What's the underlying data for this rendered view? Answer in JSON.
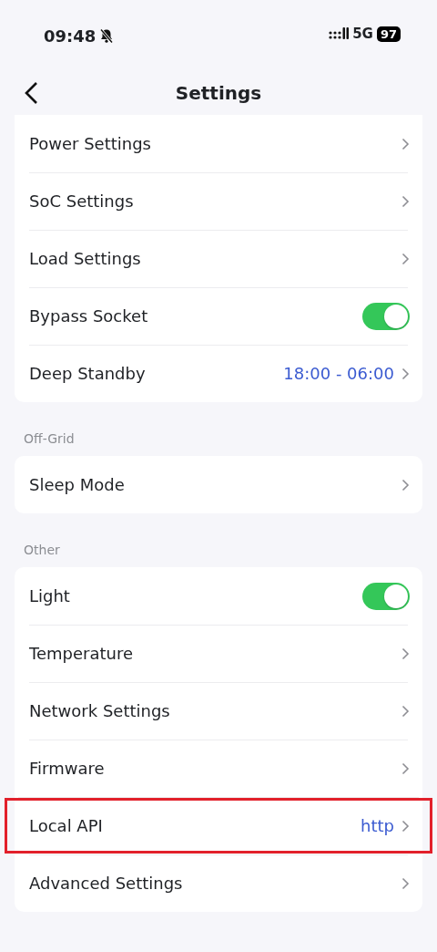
{
  "status_bar": {
    "time": "09:48",
    "network": "5G",
    "battery": "97"
  },
  "header": {
    "title": "Settings"
  },
  "sections": [
    {
      "items": [
        {
          "label": "Power Settings",
          "kind": "link",
          "highlighted": false
        },
        {
          "label": "SoC Settings",
          "kind": "link",
          "highlighted": false
        },
        {
          "label": "Load Settings",
          "kind": "link",
          "highlighted": false
        },
        {
          "label": "Bypass Socket",
          "kind": "toggle",
          "on": true,
          "highlighted": false
        },
        {
          "label": "Deep Standby",
          "kind": "link",
          "value": "18:00 - 06:00",
          "highlighted": false
        }
      ]
    },
    {
      "title": "Off-Grid",
      "items": [
        {
          "label": "Sleep Mode",
          "kind": "link",
          "highlighted": false
        }
      ]
    },
    {
      "title": "Other",
      "items": [
        {
          "label": "Light",
          "kind": "toggle",
          "on": true,
          "highlighted": false
        },
        {
          "label": "Temperature",
          "kind": "link",
          "highlighted": false
        },
        {
          "label": "Network Settings",
          "kind": "link",
          "highlighted": false
        },
        {
          "label": "Firmware",
          "kind": "link",
          "highlighted": false
        },
        {
          "label": "Local API",
          "kind": "link",
          "value": "http",
          "highlighted": true
        },
        {
          "label": "Advanced Settings",
          "kind": "link",
          "highlighted": false
        }
      ]
    }
  ]
}
